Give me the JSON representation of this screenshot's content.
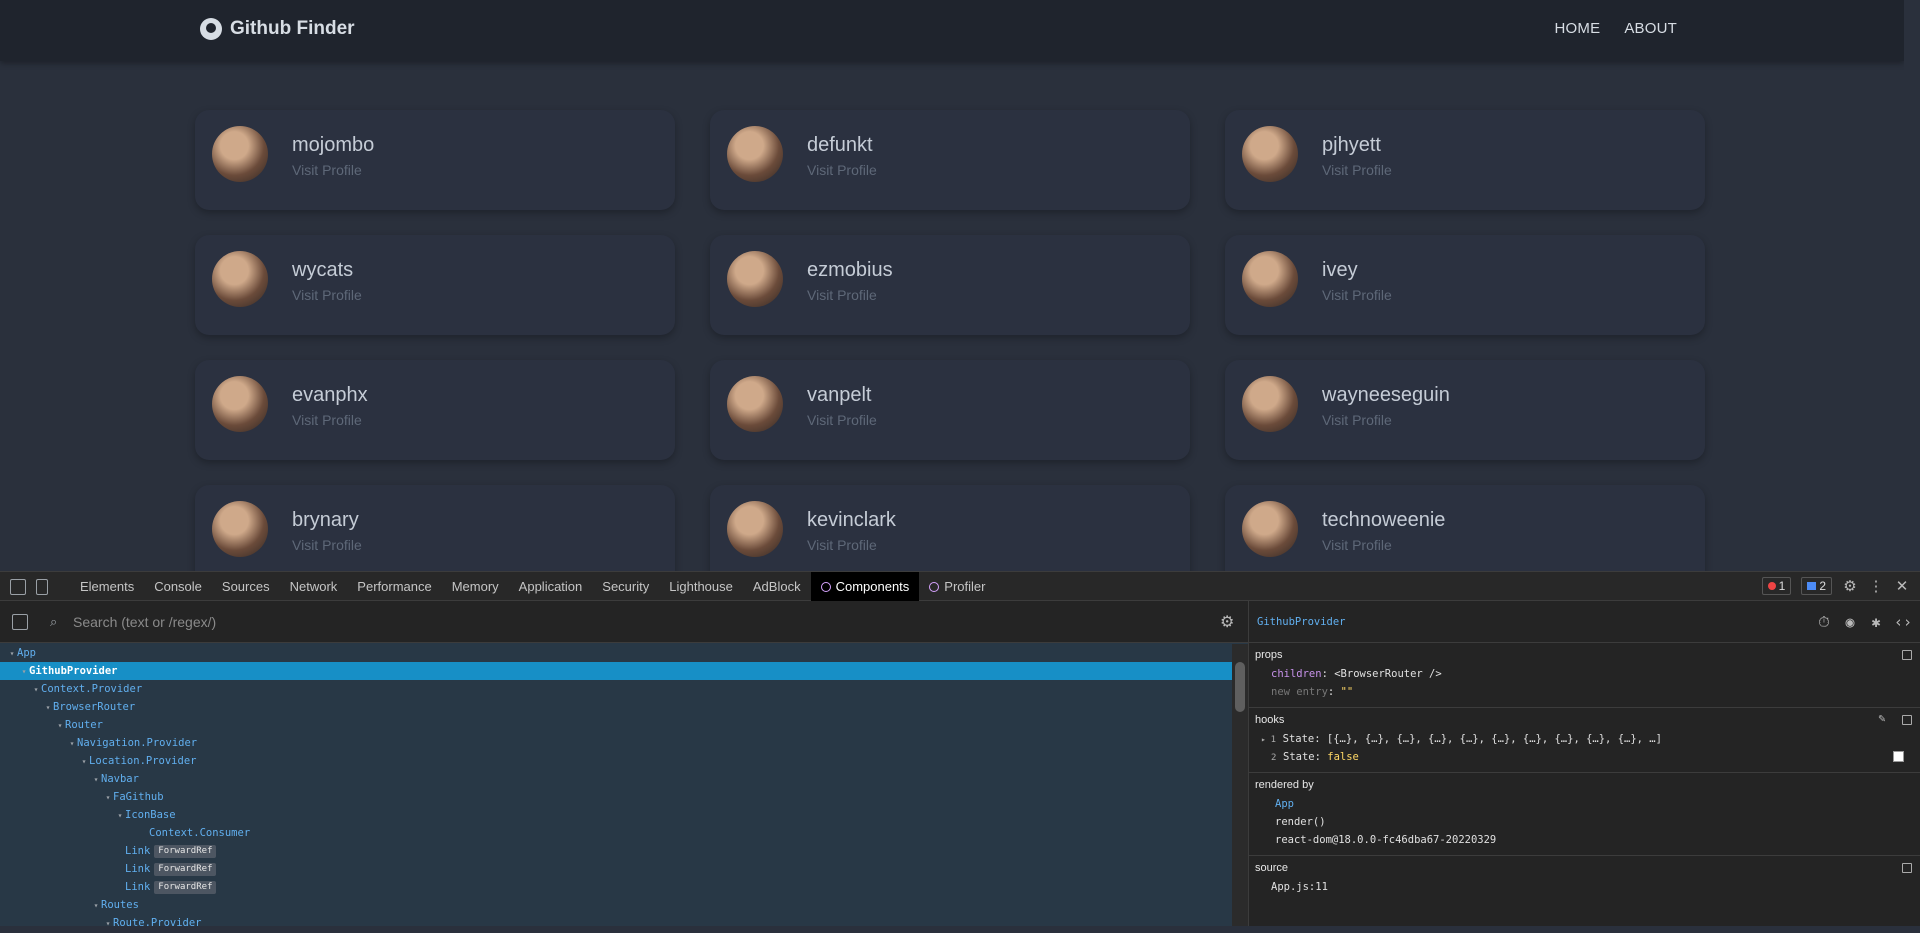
{
  "app": {
    "brand": "Github Finder",
    "nav": [
      "HOME",
      "ABOUT"
    ]
  },
  "users": [
    {
      "login": "mojombo",
      "link": "Visit Profile"
    },
    {
      "login": "defunkt",
      "link": "Visit Profile"
    },
    {
      "login": "pjhyett",
      "link": "Visit Profile"
    },
    {
      "login": "wycats",
      "link": "Visit Profile"
    },
    {
      "login": "ezmobius",
      "link": "Visit Profile"
    },
    {
      "login": "ivey",
      "link": "Visit Profile"
    },
    {
      "login": "evanphx",
      "link": "Visit Profile"
    },
    {
      "login": "vanpelt",
      "link": "Visit Profile"
    },
    {
      "login": "wayneeseguin",
      "link": "Visit Profile"
    },
    {
      "login": "brynary",
      "link": "Visit Profile"
    },
    {
      "login": "kevinclark",
      "link": "Visit Profile"
    },
    {
      "login": "technoweenie",
      "link": "Visit Profile"
    }
  ],
  "devtools": {
    "tabs": [
      "Elements",
      "Console",
      "Sources",
      "Network",
      "Performance",
      "Memory",
      "Application",
      "Security",
      "Lighthouse",
      "AdBlock",
      "Components",
      "Profiler"
    ],
    "active_tab": "Components",
    "error_count": "1",
    "message_count": "2",
    "search_placeholder": "Search (text or /regex/)",
    "tree": [
      {
        "name": "App",
        "arrow": "▾"
      },
      {
        "name": "GithubProvider",
        "arrow": "▾",
        "selected": true
      },
      {
        "name": "Context.Provider",
        "arrow": "▾"
      },
      {
        "name": "BrowserRouter",
        "arrow": "▾"
      },
      {
        "name": "Router",
        "arrow": "▾"
      },
      {
        "name": "Navigation.Provider",
        "arrow": "▾"
      },
      {
        "name": "Location.Provider",
        "arrow": "▾"
      },
      {
        "name": "Navbar",
        "arrow": "▾"
      },
      {
        "name": "FaGithub",
        "arrow": "▾"
      },
      {
        "name": "IconBase",
        "arrow": "▾"
      },
      {
        "name": "Context.Consumer",
        "arrow": ""
      },
      {
        "name": "Link",
        "arrow": "",
        "tag": "ForwardRef"
      },
      {
        "name": "Link",
        "arrow": "",
        "tag": "ForwardRef"
      },
      {
        "name": "Link",
        "arrow": "",
        "tag": "ForwardRef"
      },
      {
        "name": "Routes",
        "arrow": "▾"
      },
      {
        "name": "Route.Provider",
        "arrow": "▾"
      }
    ],
    "inspector": {
      "component": "GithubProvider",
      "props_title": "props",
      "props": [
        {
          "key": "children",
          "value": "<BrowserRouter />"
        },
        {
          "key": "new entry",
          "value": "\"\""
        }
      ],
      "hooks_title": "hooks",
      "hooks": [
        {
          "num": "1",
          "label": "State:",
          "value": "[{…}, {…}, {…}, {…}, {…}, {…}, {…}, {…}, {…}, {…}, …]"
        },
        {
          "num": "2",
          "label": "State:",
          "value": "false"
        }
      ],
      "rendered_by_title": "rendered by",
      "rendered_by": [
        "App",
        "render()",
        "react-dom@18.0.0-fc46dba67-20220329"
      ],
      "source_title": "source",
      "source": "App.js:11"
    }
  }
}
